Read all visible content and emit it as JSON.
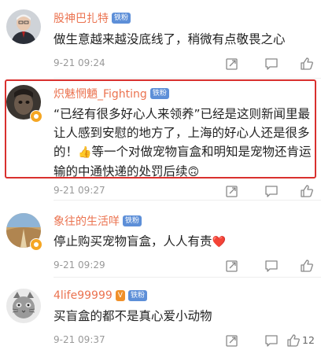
{
  "comments": [
    {
      "name": "股神巴扎特",
      "badge": "铁粉",
      "text": "做生意越来越没底线了，稍微有点敬畏之心",
      "time": "9-21 09:24",
      "likes": ""
    },
    {
      "name": "炽魅惘魉_Fighting",
      "badge": "铁粉",
      "text_part1": "“已经有很多好心人来领养”已经是这则新闻里最让人感到安慰的地方了，上海的好心人还是很多的！",
      "emoji1": "👍",
      "text_part2": "等一个对做宠物盲盒和明知是宠物还肯运输的中通快递的处罚后续",
      "emoji2": "🙃",
      "time": "9-21 09:27",
      "likes": ""
    },
    {
      "name": "象往的生活咩",
      "badge": "铁粉",
      "text": "停止购买宠物盲盒，人人有责",
      "emoji": "❤️",
      "time": "9-21 09:29",
      "likes": ""
    },
    {
      "name": "4life99999",
      "level": "V",
      "badge": "铁粉",
      "text": "买盲盒的都不是真心爱小动物",
      "time": "9-21 09:37",
      "likes": "12"
    }
  ],
  "colors": {
    "username": "#eb7350",
    "badge": "#5d8fd8",
    "highlight": "#d9302e",
    "text": "#222222",
    "time": "#999999"
  },
  "icons": [
    "share-icon",
    "comment-icon",
    "like-icon"
  ]
}
